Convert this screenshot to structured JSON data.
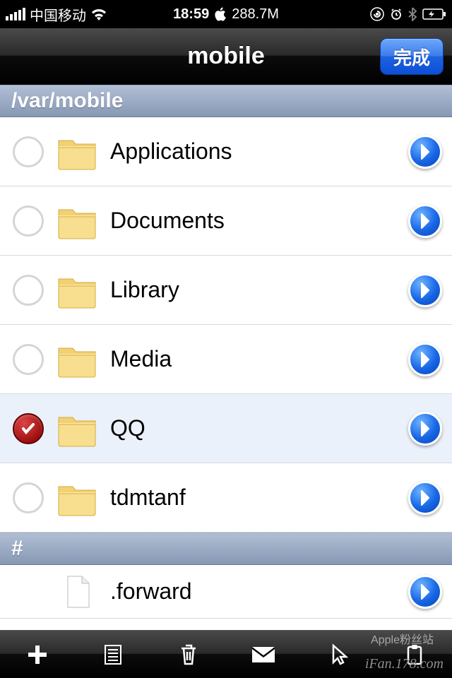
{
  "status": {
    "carrier": "中国移动",
    "time": "18:59",
    "mem": "288.7M"
  },
  "nav": {
    "title": "mobile",
    "done": "完成"
  },
  "path_header": "/var/mobile",
  "hash_header": "#",
  "items": [
    {
      "name": "Applications",
      "type": "folder",
      "selected": false
    },
    {
      "name": "Documents",
      "type": "folder",
      "selected": false
    },
    {
      "name": "Library",
      "type": "folder",
      "selected": false
    },
    {
      "name": "Media",
      "type": "folder",
      "selected": false
    },
    {
      "name": "QQ",
      "type": "folder",
      "selected": true
    },
    {
      "name": "tdmtanf",
      "type": "folder",
      "selected": false
    }
  ],
  "hash_items": [
    {
      "name": ".forward",
      "type": "file",
      "selected": false
    }
  ],
  "watermark": "iFan.178.com",
  "watermark_cn": "Apple粉丝站"
}
